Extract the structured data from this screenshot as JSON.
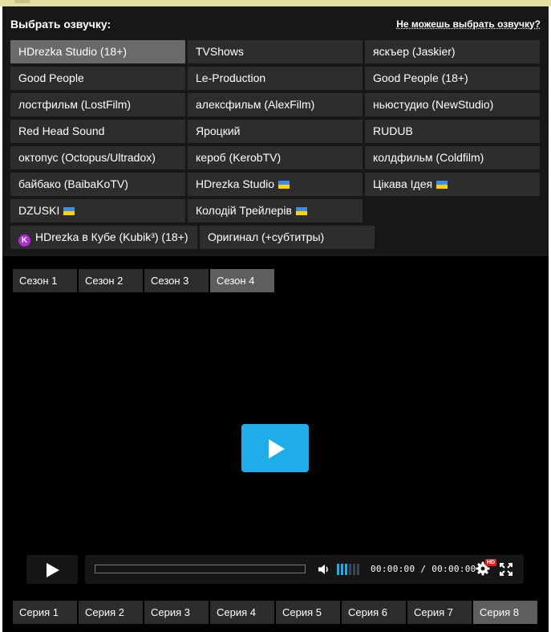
{
  "translators": {
    "title": "Выбрать озвучку:",
    "help_link": "Не можешь выбрать озвучку?",
    "items": [
      {
        "label": "HDrezka Studio (18+)",
        "active": true
      },
      {
        "label": "TVShows"
      },
      {
        "label": "яскъер (Jaskier)"
      },
      {
        "label": "Good People"
      },
      {
        "label": "Le-Production"
      },
      {
        "label": "Good People (18+)"
      },
      {
        "label": "лостфильм (LostFilm)"
      },
      {
        "label": "алексфильм (AlexFilm)"
      },
      {
        "label": "ньюстудио (NewStudio)"
      },
      {
        "label": "Red Head Sound"
      },
      {
        "label": "Яроцкий"
      },
      {
        "label": "RUDUB"
      },
      {
        "label": "октопус (Octopus/Ultradox)"
      },
      {
        "label": "кероб (KerobTV)"
      },
      {
        "label": "колдфильм (Coldfilm)"
      },
      {
        "label": "байбако (BaibaKoTV)"
      },
      {
        "label": "HDrezka Studio",
        "flag": "ukraine-flag"
      },
      {
        "label": "Цікава Ідея",
        "flag": "ukraine-flag"
      },
      {
        "label": "DZUSKI",
        "flag": "ukraine-flag"
      },
      {
        "label": "Колодій Трейлерів",
        "flag": "ukraine-flag"
      },
      {
        "label": "HDrezka в Кубе (Kubik³) (18+)",
        "icon": "kubik-icon"
      },
      {
        "label": "Оригинал (+субтитры)"
      }
    ]
  },
  "seasons": [
    "Сезон 1",
    "Сезон 2",
    "Сезон 3",
    "Сезон 4"
  ],
  "active_season": "Сезон 4",
  "player": {
    "time_current": "00:00:00",
    "time_separator": "/",
    "time_total": "00:00:00",
    "hd_badge": "HD",
    "progress": 0,
    "volume_level": 0.5
  },
  "episodes": [
    "Серия 1",
    "Серия 2",
    "Серия 3",
    "Серия 4",
    "Серия 5",
    "Серия 6",
    "Серия 7",
    "Серия 8"
  ],
  "active_episode": "Серия 8",
  "colors": {
    "accent": "#1fadea",
    "panel": "#171717",
    "item": "#2d2d2d",
    "item_active": "#6a6a6a",
    "topbar": "#e6e0a3"
  }
}
